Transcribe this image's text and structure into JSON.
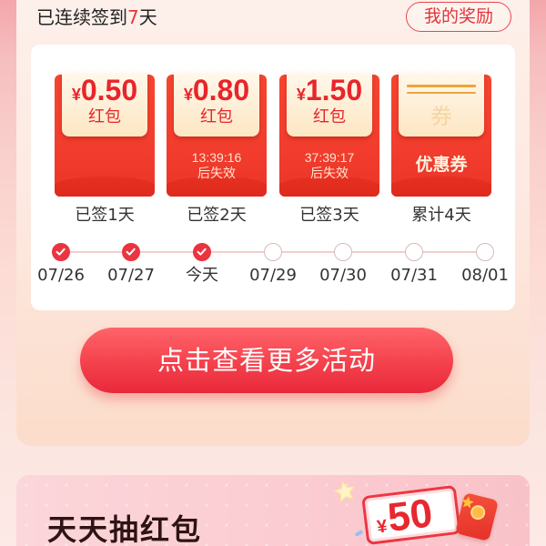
{
  "header": {
    "streak_prefix": "已连续签到",
    "streak_days": "7",
    "streak_suffix": "天",
    "rewards_button": "我的奖励"
  },
  "rewards": [
    {
      "currency": "¥",
      "amount": "0.50",
      "type": "红包",
      "caption": "已签1天"
    },
    {
      "currency": "¥",
      "amount": "0.80",
      "type": "红包",
      "countdown": "13:39:16",
      "expire_label": "后失效",
      "caption": "已签2天"
    },
    {
      "currency": "¥",
      "amount": "1.50",
      "type": "红包",
      "countdown": "37:39:17",
      "expire_label": "后失效",
      "caption": "已签3天"
    },
    {
      "watermark": "券",
      "type": "优惠券",
      "caption": "累计4天"
    }
  ],
  "timeline": [
    {
      "label": "07/26",
      "checked": true
    },
    {
      "label": "07/27",
      "checked": true
    },
    {
      "label": "今天",
      "checked": true
    },
    {
      "label": "07/29",
      "checked": false
    },
    {
      "label": "07/30",
      "checked": false
    },
    {
      "label": "07/31",
      "checked": false
    },
    {
      "label": "08/01",
      "checked": false
    }
  ],
  "cta_button": "点击查看更多活动",
  "promo": {
    "title": "天天抽红包",
    "prize_currency": "¥",
    "prize_amount": "50"
  },
  "colors": {
    "accent": "#ea3540",
    "envelope_red": "#f23d2e",
    "coupon_cream": "#fde7c4",
    "text": "#333333"
  },
  "icons": {
    "check": "check-icon",
    "star": "star-icon",
    "red_envelope": "red-envelope-icon",
    "coin": "coin-icon"
  }
}
